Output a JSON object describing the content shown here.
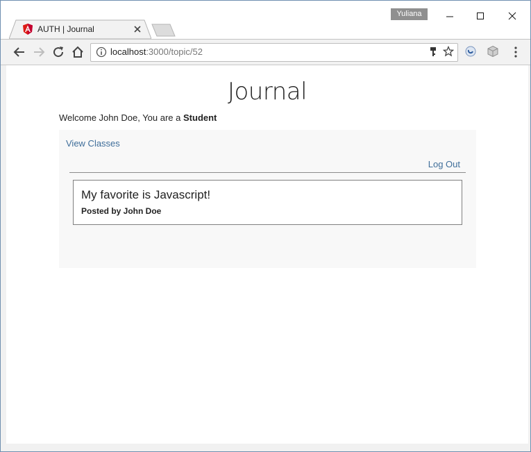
{
  "browser": {
    "profile_name": "Yuliana",
    "tab_title": "AUTH | Journal",
    "url_host": "localhost",
    "url_rest": ":3000/topic/52"
  },
  "page": {
    "title": "Journal",
    "welcome_prefix": "Welcome John Doe, You are a ",
    "role": "Student",
    "view_classes": "View Classes",
    "logout": "Log Out",
    "post": {
      "title": "My favorite is Javascript!",
      "author": "Posted by John Doe"
    }
  }
}
